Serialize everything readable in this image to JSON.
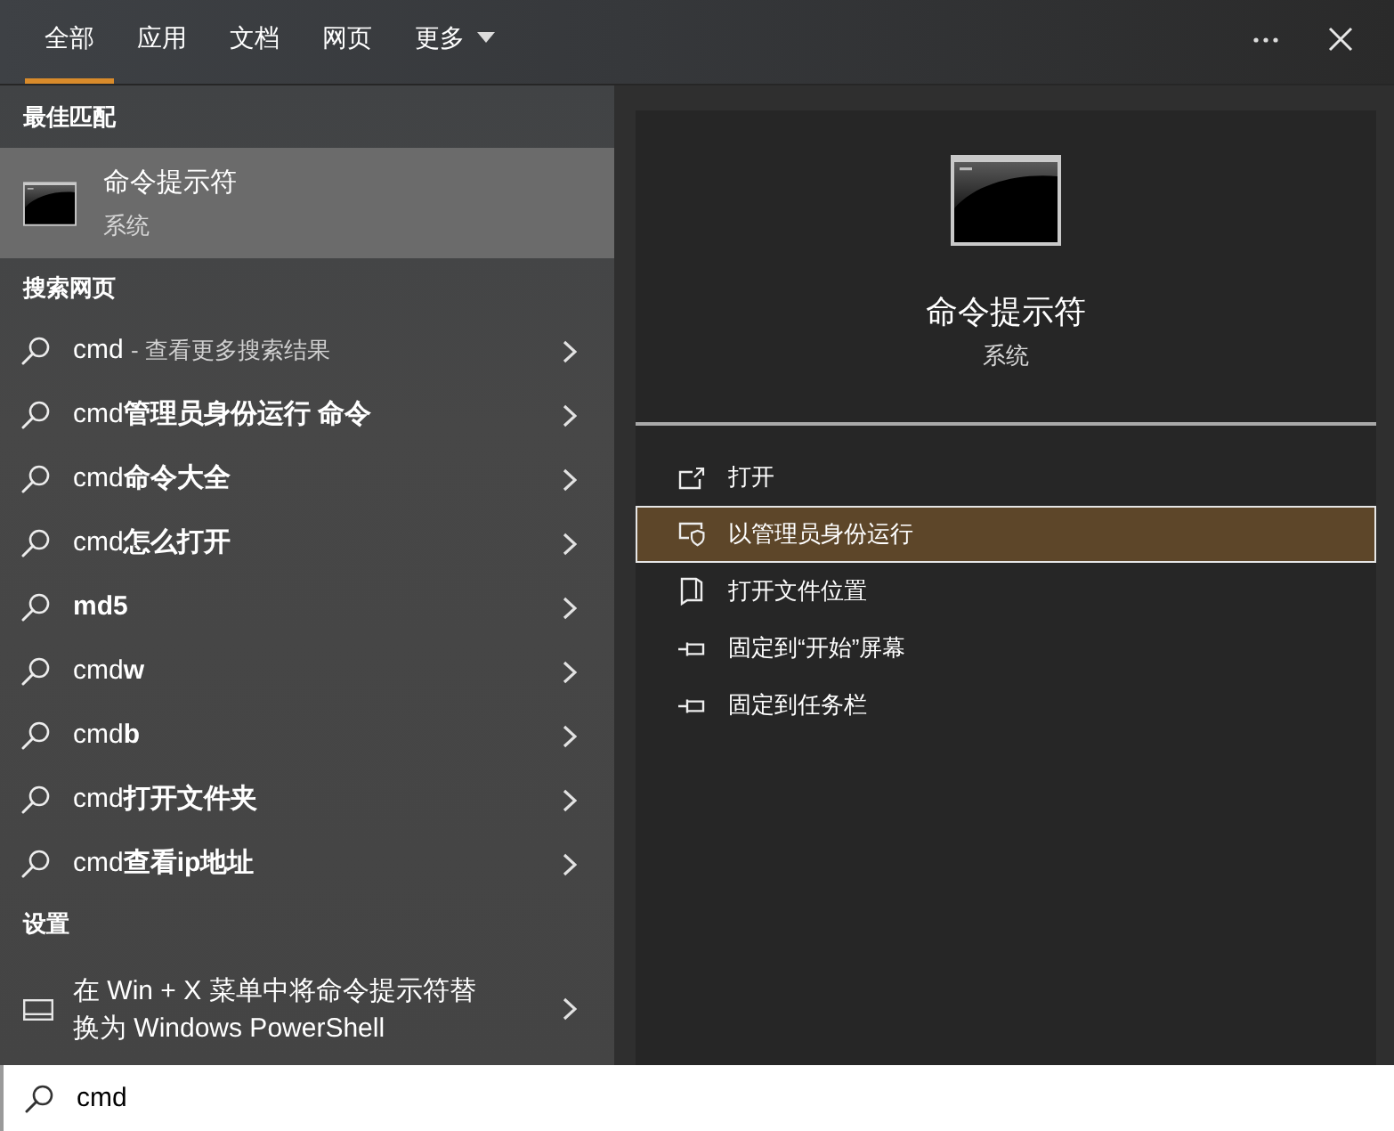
{
  "tabs": [
    {
      "label": "全部",
      "selected": true,
      "dropdown": false
    },
    {
      "label": "应用",
      "selected": false,
      "dropdown": false
    },
    {
      "label": "文档",
      "selected": false,
      "dropdown": false
    },
    {
      "label": "网页",
      "selected": false,
      "dropdown": false
    },
    {
      "label": "更多",
      "selected": false,
      "dropdown": true
    }
  ],
  "best_match": {
    "heading": "最佳匹配",
    "item": {
      "title": "命令提示符",
      "subtitle": "系统",
      "selected": true
    }
  },
  "web_search": {
    "heading": "搜索网页",
    "items": [
      {
        "kind": "more",
        "query": "cmd",
        "note": "- 查看更多搜索结果"
      },
      {
        "kind": "suggestion",
        "prefix": "cmd",
        "completion": "管理员身份运行 命令"
      },
      {
        "kind": "suggestion",
        "prefix": "cmd",
        "completion": "命令大全"
      },
      {
        "kind": "suggestion",
        "prefix": "cmd",
        "completion": "怎么打开"
      },
      {
        "kind": "suggestion",
        "completion": "md5"
      },
      {
        "kind": "suggestion",
        "prefix": "cmd",
        "completion": "w"
      },
      {
        "kind": "suggestion",
        "prefix": "cmd",
        "completion": "b"
      },
      {
        "kind": "suggestion",
        "prefix": "cmd",
        "completion": "打开文件夹"
      },
      {
        "kind": "suggestion",
        "prefix": "cmd",
        "completion": "查看ip地址"
      }
    ]
  },
  "settings": {
    "heading": "设置",
    "items": [
      {
        "text": "在 Win + X 菜单中将命令提示符替换为 Windows PowerShell"
      }
    ]
  },
  "detail": {
    "title": "命令提示符",
    "subtitle": "系统",
    "actions": [
      {
        "kind": "open",
        "label": "打开",
        "selected": false
      },
      {
        "kind": "admin",
        "label": "以管理员身份运行",
        "selected": true
      },
      {
        "kind": "location",
        "label": "打开文件位置",
        "selected": false
      },
      {
        "kind": "pin",
        "label": "固定到“开始”屏幕",
        "selected": false
      },
      {
        "kind": "pin",
        "label": "固定到任务栏",
        "selected": false
      }
    ]
  },
  "search_box": {
    "value": "cmd"
  }
}
